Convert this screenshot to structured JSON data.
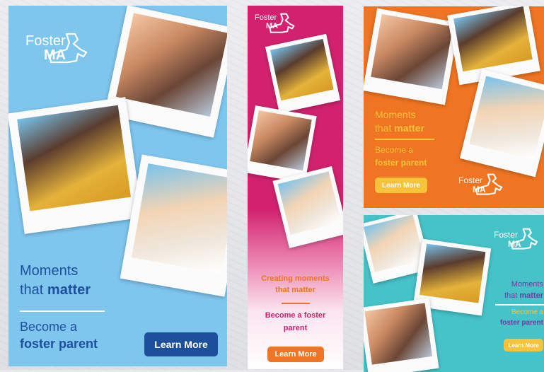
{
  "brand": {
    "logo_line1": "Foster",
    "logo_line2": "MA",
    "colors": {
      "blue_bg": "#7fc6ef",
      "pink_bg": "#d2226f",
      "orange_bg": "#f07522",
      "teal_bg": "#46c3c9",
      "navy": "#1c4f9c",
      "yellow": "#f7c33a",
      "orange_btn": "#f07522",
      "purple": "#6c3aa0"
    }
  },
  "banner_blue": {
    "line1": "Moments",
    "line2_a": "that",
    "line2_b": "matter",
    "line3": "Become a",
    "line4": "foster parent",
    "button": "Learn More"
  },
  "banner_pink": {
    "line1": "Creating moments",
    "line2": "that matter",
    "line3": "Become a foster",
    "line4": "parent",
    "button": "Learn More"
  },
  "banner_orange": {
    "line1": "Moments",
    "line2_a": "that",
    "line2_b": "matter",
    "line3": "Become a",
    "line4": "foster parent",
    "button": "Learn More"
  },
  "banner_teal": {
    "line1": "Moments",
    "line2_a": "that",
    "line2_b": "matter",
    "line3": "Become a",
    "line4": "foster parent",
    "button": "Learn More"
  },
  "photos": {
    "trio": "three-girls-photo",
    "boy": "thinking-boy-photo",
    "girl": "girl-raising-hand-photo"
  }
}
